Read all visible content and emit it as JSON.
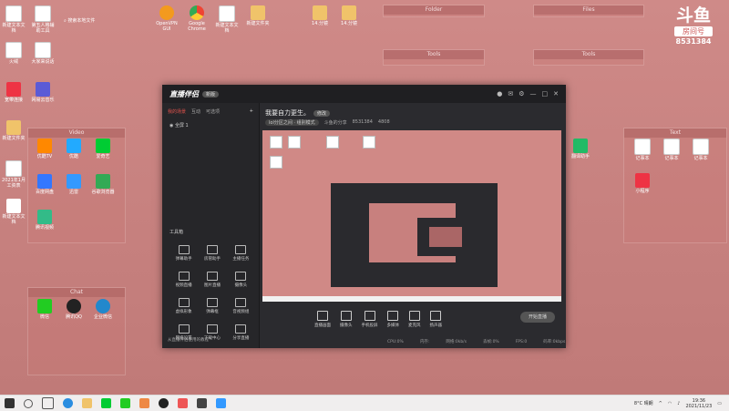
{
  "desktop": {
    "fences": [
      {
        "name": "Folder",
        "label": ""
      },
      {
        "name": "Files",
        "label": ""
      },
      {
        "name": "Tools",
        "label": ""
      },
      {
        "name": "Tools",
        "label": ""
      },
      {
        "name": "Video",
        "label": ""
      },
      {
        "name": "Text",
        "label": ""
      },
      {
        "name": "Chat",
        "label": ""
      }
    ],
    "fence_titles": [
      "Folder",
      "Files",
      "Tools",
      "Tools",
      "Video",
      "Text",
      "Chat"
    ],
    "search_hint": "搜索本地文件",
    "icons_left": [
      "新建文本文档",
      "第五人格辅助工具",
      "火绒",
      "大家来说话",
      "宽带连接",
      "网易云音乐",
      "新建文件夹",
      "2021年1月工资表",
      "新建文本文档"
    ],
    "icons_top": [
      "OpenVPN GUI",
      "Google Chrome",
      "新建文本文档",
      "新建文件夹",
      "14.分镜",
      "14.分镜"
    ],
    "icons_video": [
      "优酷TV",
      "优酷",
      "爱奇艺",
      "百度网盘",
      "迅雷",
      "谷歌浏览器",
      "腾讯视频"
    ],
    "icons_chat": [
      "微信",
      "腾讯QQ",
      "企业微信"
    ],
    "icons_right": [
      "翻译助手",
      "记事本",
      "记事本",
      "记事本",
      "小程序"
    ],
    "watermark": {
      "big": "斗鱼",
      "bar": "房间号",
      "num": "8531384"
    }
  },
  "app": {
    "logo": "直播伴侣",
    "version": "新版",
    "tabs": [
      "我的场景",
      "互动",
      "可选项"
    ],
    "scene": "全屏 1",
    "room_title": "我要自力更生。",
    "edit_label": "修改",
    "category": "lol分区之间 · 组别模式",
    "room_label": "斗鱼的分享",
    "room_id": "8531384",
    "hot": "4808",
    "toolbox_title": "工具箱",
    "tools": [
      "弹幕助手",
      "房管助手",
      "主播任务",
      "视频直播",
      "图片直播",
      "摄像头",
      "虚拟形象",
      "弹幕框",
      "音视频组",
      "网络设置",
      "下载中心",
      "分享直播"
    ],
    "left_footer": "从直播伴侣使用的教程",
    "bottom_buttons": [
      "直播画面",
      "摄像头",
      "手机投屏",
      "多媒体",
      "麦克风",
      "扬声器"
    ],
    "start_button": "开始直播",
    "status": [
      "CPU:0%",
      "内存:",
      "网络:0kb/s",
      "丢帧:0%",
      "FPS:0",
      "码率:0kbps"
    ]
  },
  "taskbar": {
    "weather": "8°C 晴朗",
    "time": "19:36",
    "date": "2021/11/23"
  }
}
